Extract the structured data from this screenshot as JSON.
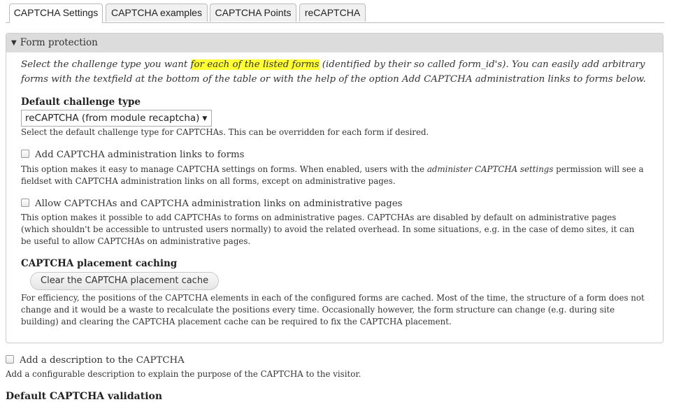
{
  "tabs": [
    {
      "label": "CAPTCHA Settings",
      "active": true
    },
    {
      "label": "CAPTCHA examples",
      "active": false
    },
    {
      "label": "CAPTCHA Points",
      "active": false
    },
    {
      "label": "reCAPTCHA",
      "active": false
    }
  ],
  "form_protection": {
    "legend": "Form protection",
    "intro_before": "Select the challenge type you want ",
    "intro_highlight": "for each of the listed forms",
    "intro_after": " (identified by their so called form_id's). You can easily add arbitrary forms with the textfield at the bottom of the table or with the help of the option Add CAPTCHA administration links to forms below.",
    "highlight_color": "#ffff33",
    "default_challenge": {
      "label": "Default challenge type",
      "selected": "reCAPTCHA (from module recaptcha)",
      "description": "Select the default challenge type for CAPTCHAs. This can be overridden for each form if desired."
    },
    "admin_links": {
      "label": "Add CAPTCHA administration links to forms",
      "checked": false,
      "desc_before": "This option makes it easy to manage CAPTCHA settings on forms. When enabled, users with the ",
      "desc_em": "administer CAPTCHA settings",
      "desc_after": " permission will see a fieldset with CAPTCHA administration links on all forms, except on administrative pages."
    },
    "allow_admin_pages": {
      "label": "Allow CAPTCHAs and CAPTCHA administration links on administrative pages",
      "checked": false,
      "description": "This option makes it possible to add CAPTCHAs to forms on administrative pages. CAPTCHAs are disabled by default on administrative pages (which shouldn't be accessible to untrusted users normally) to avoid the related overhead. In some situations, e.g. in the case of demo sites, it can be useful to allow CAPTCHAs on administrative pages."
    },
    "placement_caching": {
      "label": "CAPTCHA placement caching",
      "button": "Clear the CAPTCHA placement cache",
      "description": "For efficiency, the positions of the CAPTCHA elements in each of the configured forms are cached. Most of the time, the structure of a form does not change and it would be a waste to recalculate the positions every time. Occasionally however, the form structure can change (e.g. during site building) and clearing the CAPTCHA placement cache can be required to fix the CAPTCHA placement."
    }
  },
  "add_description": {
    "label": "Add a description to the CAPTCHA",
    "checked": false,
    "description": "Add a configurable description to explain the purpose of the CAPTCHA to the visitor."
  },
  "default_validation": {
    "label": "Default CAPTCHA validation"
  }
}
